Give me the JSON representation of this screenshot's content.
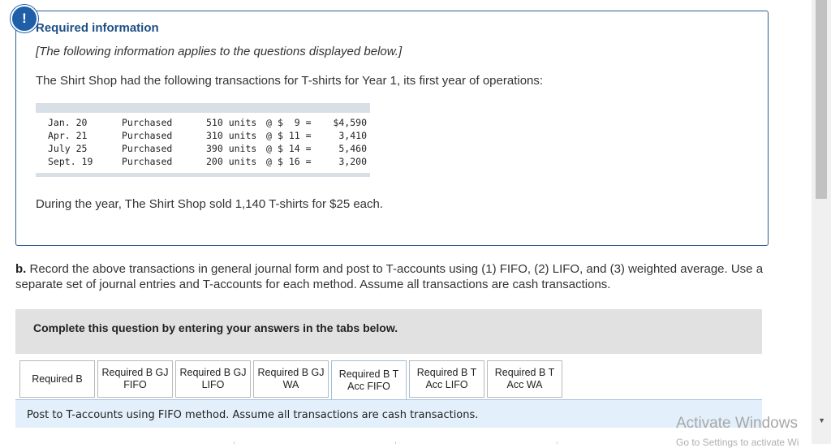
{
  "alert": {
    "symbol": "!"
  },
  "info": {
    "title": "Required information",
    "note": "[The following information applies to the questions displayed below.]",
    "description": "The Shirt Shop had the following transactions for T-shirts for Year 1, its first year of operations:",
    "transactions": [
      {
        "date": "Jan. 20",
        "type": "Purchased",
        "units": "510 units",
        "at": "@",
        "price": "$  9 =",
        "total": "$4,590"
      },
      {
        "date": "Apr. 21",
        "type": "Purchased",
        "units": "310 units",
        "at": "@",
        "price": "$ 11 =",
        "total": "3,410"
      },
      {
        "date": "July 25",
        "type": "Purchased",
        "units": "390 units",
        "at": "@",
        "price": "$ 14 =",
        "total": "5,460"
      },
      {
        "date": "Sept. 19",
        "type": "Purchased",
        "units": "200 units",
        "at": "@",
        "price": "$ 16 =",
        "total": "3,200"
      }
    ],
    "sold": "During the year, The Shirt Shop sold 1,140 T-shirts for $25 each."
  },
  "question": {
    "label": "b.",
    "text": "Record the above transactions in general journal form and post to T-accounts using (1) FIFO, (2) LIFO, and (3) weighted average. Use a separate set of journal entries and T-accounts for each method. Assume all transactions are cash transactions."
  },
  "instructions": "Complete this question by entering your answers in the tabs below.",
  "tabs": [
    {
      "line1": "Required B",
      "line2": ""
    },
    {
      "line1": "Required B GJ",
      "line2": "FIFO"
    },
    {
      "line1": "Required B GJ",
      "line2": "LIFO"
    },
    {
      "line1": "Required B GJ",
      "line2": "WA"
    },
    {
      "line1": "Required B T",
      "line2": "Acc FIFO"
    },
    {
      "line1": "Required B T",
      "line2": "Acc LIFO"
    },
    {
      "line1": "Required B T",
      "line2": "Acc WA"
    }
  ],
  "panel_text": "Post to T-accounts using FIFO method. Assume all transactions are cash transactions.",
  "watermark": {
    "title": "Activate Windows",
    "subtitle": "Go to Settings to activate Wi"
  }
}
